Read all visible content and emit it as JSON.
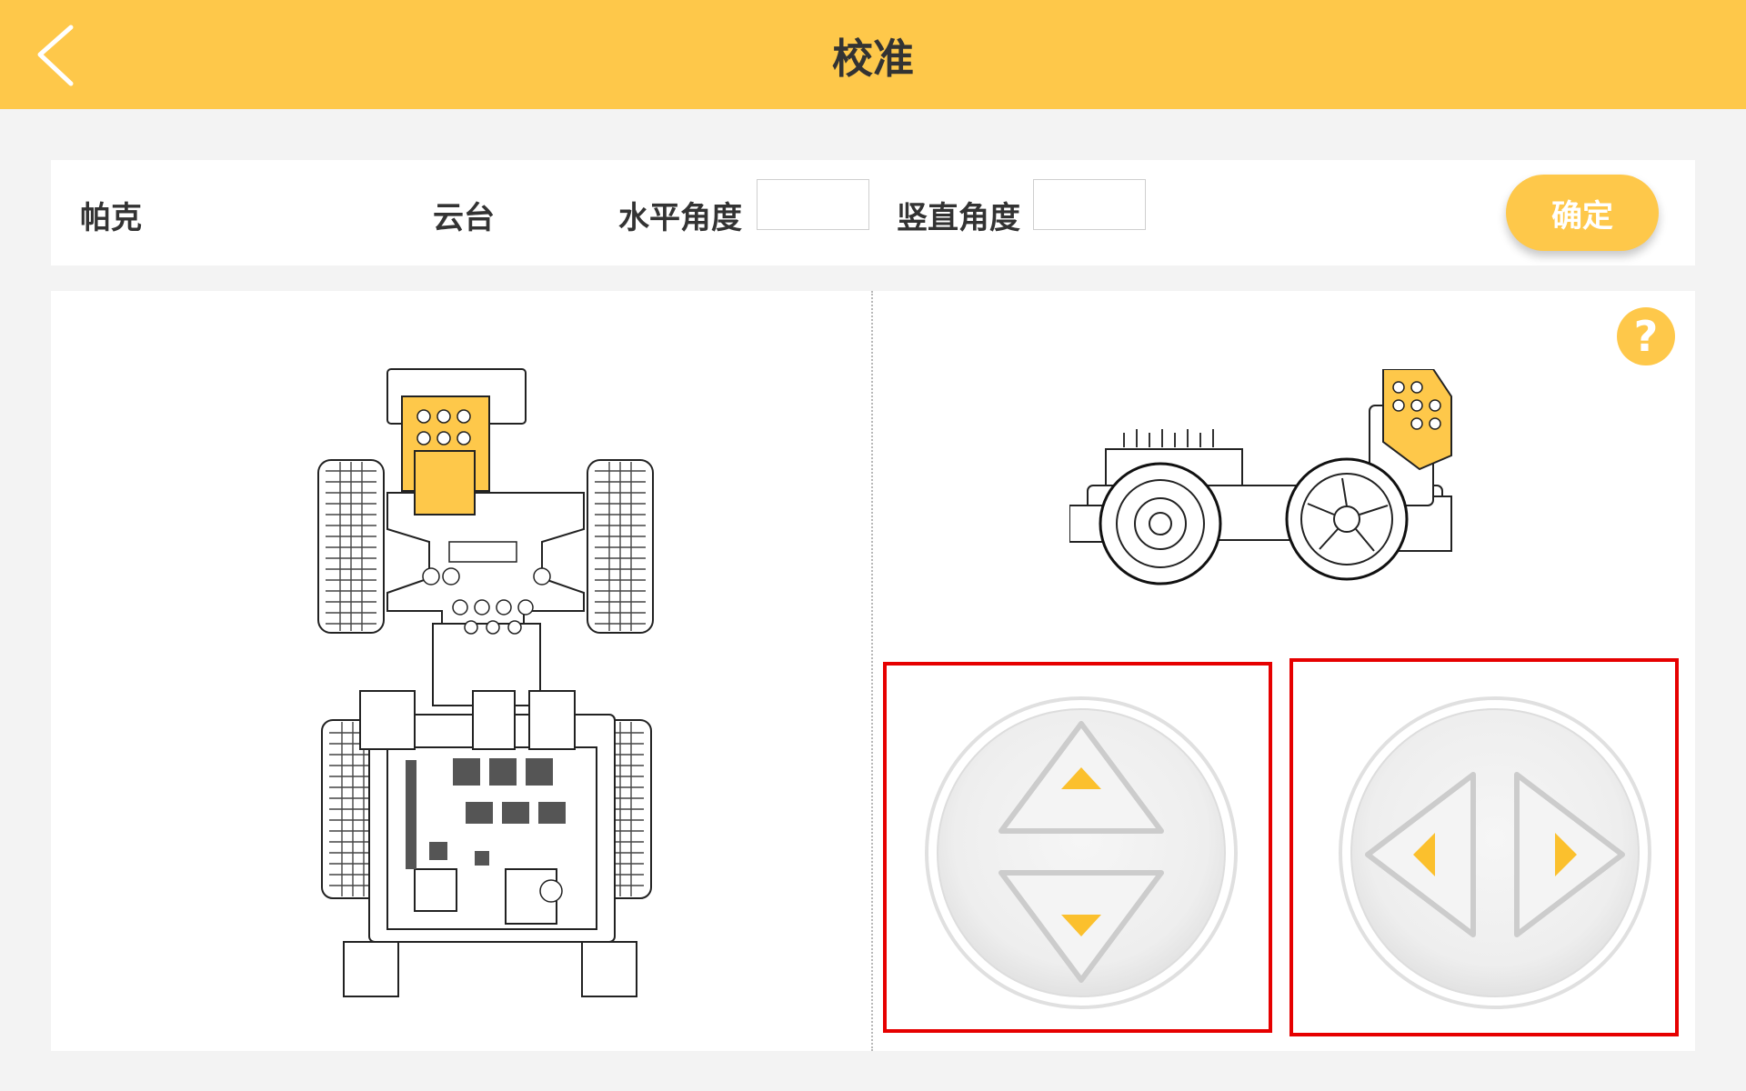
{
  "header": {
    "title": "校准",
    "back_icon": "chevron-left-icon"
  },
  "settings": {
    "model_label": "帕克",
    "module_label": "云台",
    "horizontal_label": "水平角度",
    "horizontal_value": "",
    "vertical_label": "竖直角度",
    "vertical_value": "",
    "confirm_label": "确定"
  },
  "help": {
    "label": "?"
  },
  "colors": {
    "header_bg": "#fec84a",
    "accent": "#fec84a",
    "arrow": "#fbc02d",
    "highlight_border": "#e60000",
    "background": "#f3f3f3"
  },
  "controls": {
    "vertical_control_icons": [
      "arrow-up-icon",
      "arrow-down-icon"
    ],
    "horizontal_control_icons": [
      "arrow-left-icon",
      "arrow-right-icon"
    ]
  }
}
